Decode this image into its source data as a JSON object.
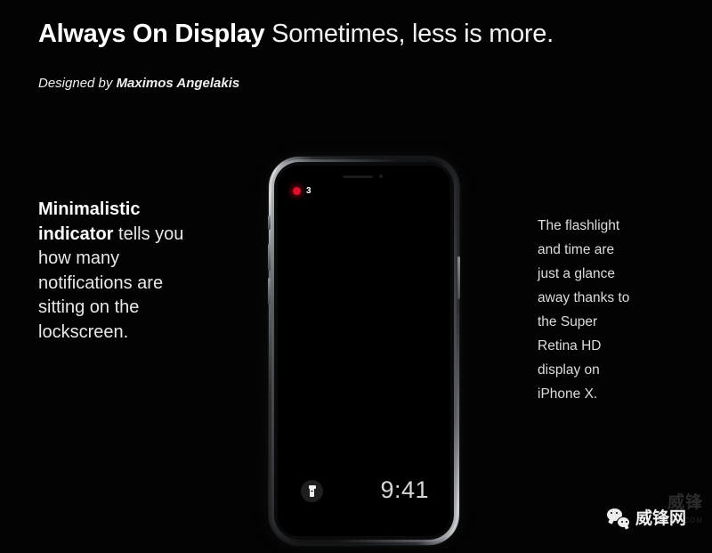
{
  "header": {
    "headline_bold": "Always On Display",
    "headline_light": "Sometimes, less is more.",
    "byline_lead": "Designed by ",
    "byline_name": "Maximos Angelakis"
  },
  "copy": {
    "left_strong": "Minimalistic indicator",
    "left_rest": " tells you how many notifications are sitting on the lockscreen.",
    "right": "The flashlight and time are just a glance away thanks to the Super Retina HD display on iPhone X."
  },
  "phone": {
    "notification_count": "3",
    "notification_dot_color": "#e0102a",
    "clock": "9:41",
    "flashlight_icon": "flashlight-icon",
    "earpiece_icon": "speaker-slit-icon",
    "sensor_icon": "proximity-sensor-icon",
    "buttons": {
      "mute": "mute-switch",
      "volume_up": "volume-up-button",
      "volume_down": "volume-down-button",
      "power": "power-button"
    }
  },
  "watermark": {
    "brand": "威锋网",
    "ghost_brand": "威锋",
    "ghost_domain": "FENG.COM",
    "icon": "wechat-icon"
  }
}
